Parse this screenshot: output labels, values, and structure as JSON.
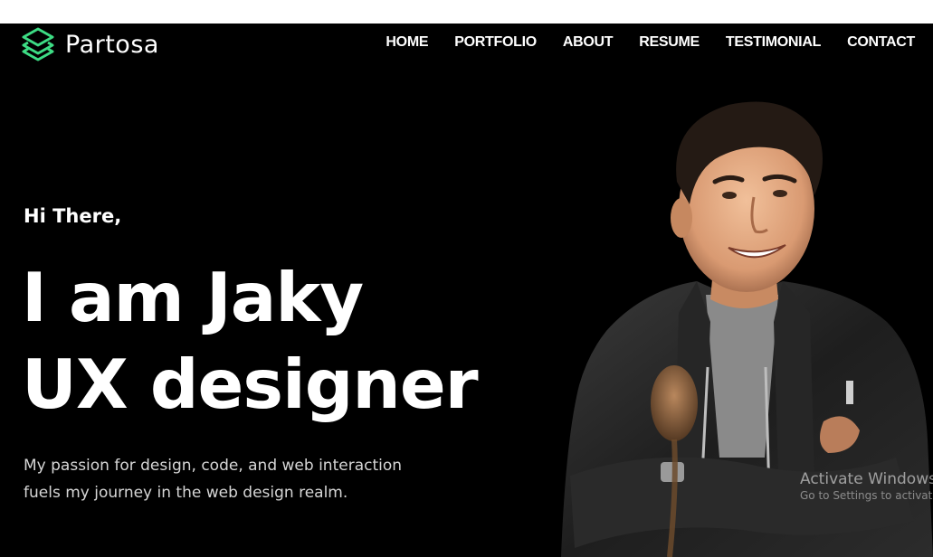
{
  "brand": {
    "name": "Partosa",
    "icon": "layers-icon",
    "accent_color": "#3ddc84"
  },
  "nav": {
    "items": [
      "HOME",
      "PORTFOLIO",
      "ABOUT",
      "RESUME",
      "TESTIMONIAL",
      "CONTACT"
    ]
  },
  "hero": {
    "greeting": "Hi There,",
    "headline_line1": "I am Jaky",
    "headline_line2": "UX designer",
    "description_line1": "My passion for design, code, and web interaction",
    "description_line2": "fuels my journey in the web design realm."
  },
  "watermark": {
    "title": "Activate Windows",
    "subtitle": "Go to Settings to activate Windows."
  },
  "colors": {
    "background": "#000000",
    "text": "#ffffff",
    "muted_text": "#d6d6d6"
  }
}
